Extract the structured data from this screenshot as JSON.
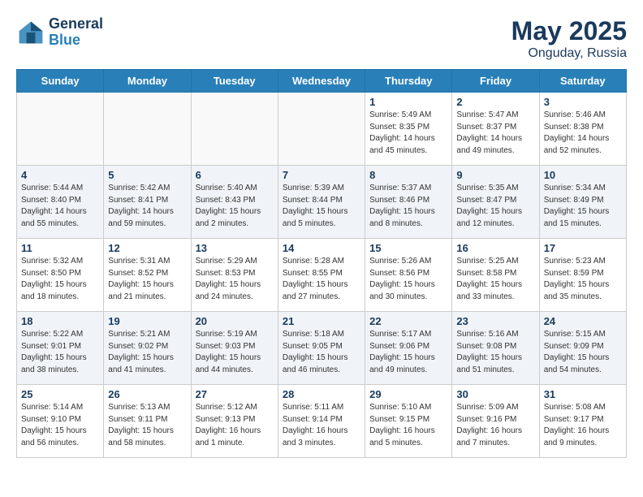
{
  "header": {
    "logo_line1": "General",
    "logo_line2": "Blue",
    "month": "May 2025",
    "location": "Onguday, Russia"
  },
  "days_of_week": [
    "Sunday",
    "Monday",
    "Tuesday",
    "Wednesday",
    "Thursday",
    "Friday",
    "Saturday"
  ],
  "weeks": [
    [
      {
        "day": "",
        "info": [],
        "empty": true
      },
      {
        "day": "",
        "info": [],
        "empty": true
      },
      {
        "day": "",
        "info": [],
        "empty": true
      },
      {
        "day": "",
        "info": [],
        "empty": true
      },
      {
        "day": "1",
        "info": [
          "Sunrise: 5:49 AM",
          "Sunset: 8:35 PM",
          "Daylight: 14 hours",
          "and 45 minutes."
        ],
        "empty": false
      },
      {
        "day": "2",
        "info": [
          "Sunrise: 5:47 AM",
          "Sunset: 8:37 PM",
          "Daylight: 14 hours",
          "and 49 minutes."
        ],
        "empty": false
      },
      {
        "day": "3",
        "info": [
          "Sunrise: 5:46 AM",
          "Sunset: 8:38 PM",
          "Daylight: 14 hours",
          "and 52 minutes."
        ],
        "empty": false
      }
    ],
    [
      {
        "day": "4",
        "info": [
          "Sunrise: 5:44 AM",
          "Sunset: 8:40 PM",
          "Daylight: 14 hours",
          "and 55 minutes."
        ],
        "empty": false
      },
      {
        "day": "5",
        "info": [
          "Sunrise: 5:42 AM",
          "Sunset: 8:41 PM",
          "Daylight: 14 hours",
          "and 59 minutes."
        ],
        "empty": false
      },
      {
        "day": "6",
        "info": [
          "Sunrise: 5:40 AM",
          "Sunset: 8:43 PM",
          "Daylight: 15 hours",
          "and 2 minutes."
        ],
        "empty": false
      },
      {
        "day": "7",
        "info": [
          "Sunrise: 5:39 AM",
          "Sunset: 8:44 PM",
          "Daylight: 15 hours",
          "and 5 minutes."
        ],
        "empty": false
      },
      {
        "day": "8",
        "info": [
          "Sunrise: 5:37 AM",
          "Sunset: 8:46 PM",
          "Daylight: 15 hours",
          "and 8 minutes."
        ],
        "empty": false
      },
      {
        "day": "9",
        "info": [
          "Sunrise: 5:35 AM",
          "Sunset: 8:47 PM",
          "Daylight: 15 hours",
          "and 12 minutes."
        ],
        "empty": false
      },
      {
        "day": "10",
        "info": [
          "Sunrise: 5:34 AM",
          "Sunset: 8:49 PM",
          "Daylight: 15 hours",
          "and 15 minutes."
        ],
        "empty": false
      }
    ],
    [
      {
        "day": "11",
        "info": [
          "Sunrise: 5:32 AM",
          "Sunset: 8:50 PM",
          "Daylight: 15 hours",
          "and 18 minutes."
        ],
        "empty": false
      },
      {
        "day": "12",
        "info": [
          "Sunrise: 5:31 AM",
          "Sunset: 8:52 PM",
          "Daylight: 15 hours",
          "and 21 minutes."
        ],
        "empty": false
      },
      {
        "day": "13",
        "info": [
          "Sunrise: 5:29 AM",
          "Sunset: 8:53 PM",
          "Daylight: 15 hours",
          "and 24 minutes."
        ],
        "empty": false
      },
      {
        "day": "14",
        "info": [
          "Sunrise: 5:28 AM",
          "Sunset: 8:55 PM",
          "Daylight: 15 hours",
          "and 27 minutes."
        ],
        "empty": false
      },
      {
        "day": "15",
        "info": [
          "Sunrise: 5:26 AM",
          "Sunset: 8:56 PM",
          "Daylight: 15 hours",
          "and 30 minutes."
        ],
        "empty": false
      },
      {
        "day": "16",
        "info": [
          "Sunrise: 5:25 AM",
          "Sunset: 8:58 PM",
          "Daylight: 15 hours",
          "and 33 minutes."
        ],
        "empty": false
      },
      {
        "day": "17",
        "info": [
          "Sunrise: 5:23 AM",
          "Sunset: 8:59 PM",
          "Daylight: 15 hours",
          "and 35 minutes."
        ],
        "empty": false
      }
    ],
    [
      {
        "day": "18",
        "info": [
          "Sunrise: 5:22 AM",
          "Sunset: 9:01 PM",
          "Daylight: 15 hours",
          "and 38 minutes."
        ],
        "empty": false
      },
      {
        "day": "19",
        "info": [
          "Sunrise: 5:21 AM",
          "Sunset: 9:02 PM",
          "Daylight: 15 hours",
          "and 41 minutes."
        ],
        "empty": false
      },
      {
        "day": "20",
        "info": [
          "Sunrise: 5:19 AM",
          "Sunset: 9:03 PM",
          "Daylight: 15 hours",
          "and 44 minutes."
        ],
        "empty": false
      },
      {
        "day": "21",
        "info": [
          "Sunrise: 5:18 AM",
          "Sunset: 9:05 PM",
          "Daylight: 15 hours",
          "and 46 minutes."
        ],
        "empty": false
      },
      {
        "day": "22",
        "info": [
          "Sunrise: 5:17 AM",
          "Sunset: 9:06 PM",
          "Daylight: 15 hours",
          "and 49 minutes."
        ],
        "empty": false
      },
      {
        "day": "23",
        "info": [
          "Sunrise: 5:16 AM",
          "Sunset: 9:08 PM",
          "Daylight: 15 hours",
          "and 51 minutes."
        ],
        "empty": false
      },
      {
        "day": "24",
        "info": [
          "Sunrise: 5:15 AM",
          "Sunset: 9:09 PM",
          "Daylight: 15 hours",
          "and 54 minutes."
        ],
        "empty": false
      }
    ],
    [
      {
        "day": "25",
        "info": [
          "Sunrise: 5:14 AM",
          "Sunset: 9:10 PM",
          "Daylight: 15 hours",
          "and 56 minutes."
        ],
        "empty": false
      },
      {
        "day": "26",
        "info": [
          "Sunrise: 5:13 AM",
          "Sunset: 9:11 PM",
          "Daylight: 15 hours",
          "and 58 minutes."
        ],
        "empty": false
      },
      {
        "day": "27",
        "info": [
          "Sunrise: 5:12 AM",
          "Sunset: 9:13 PM",
          "Daylight: 16 hours",
          "and 1 minute."
        ],
        "empty": false
      },
      {
        "day": "28",
        "info": [
          "Sunrise: 5:11 AM",
          "Sunset: 9:14 PM",
          "Daylight: 16 hours",
          "and 3 minutes."
        ],
        "empty": false
      },
      {
        "day": "29",
        "info": [
          "Sunrise: 5:10 AM",
          "Sunset: 9:15 PM",
          "Daylight: 16 hours",
          "and 5 minutes."
        ],
        "empty": false
      },
      {
        "day": "30",
        "info": [
          "Sunrise: 5:09 AM",
          "Sunset: 9:16 PM",
          "Daylight: 16 hours",
          "and 7 minutes."
        ],
        "empty": false
      },
      {
        "day": "31",
        "info": [
          "Sunrise: 5:08 AM",
          "Sunset: 9:17 PM",
          "Daylight: 16 hours",
          "and 9 minutes."
        ],
        "empty": false
      }
    ]
  ]
}
